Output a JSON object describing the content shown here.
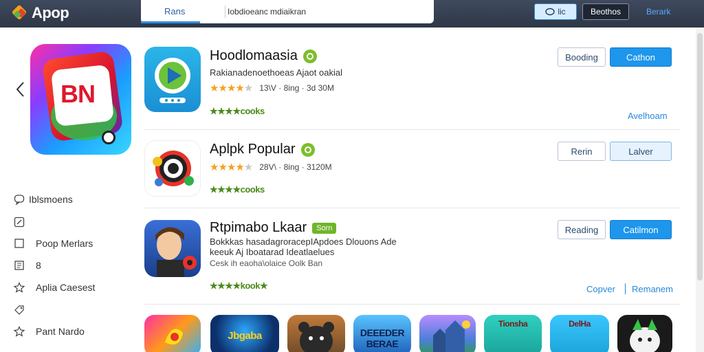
{
  "topbar": {
    "logo_text": "Apop",
    "tab_label": "Rans",
    "search_value": "Iobdioeanc mdiaikran",
    "button_1_label": "lic",
    "button_2_label": "Beothos",
    "link_label": "Berark"
  },
  "sidebar": {
    "items": [
      {
        "label": "Iblsmoens",
        "icon": "chat-bubble-icon"
      },
      {
        "label": "",
        "icon": "edit-icon"
      },
      {
        "label": "Poop Merlars",
        "icon": "square-icon"
      },
      {
        "label": "8",
        "icon": "bookmark-icon"
      },
      {
        "label": "Aplia Caesest",
        "icon": "star-outline-icon"
      },
      {
        "label": "",
        "icon": "tag-icon"
      },
      {
        "label": "Pant Nardo",
        "icon": "star-outline-icon"
      }
    ]
  },
  "apps": [
    {
      "title": "Hoodlomaasia",
      "badge": "circle",
      "subtitle": "Rakianadenoethoeas Ajaot oakial",
      "rating_stars": 4,
      "meta": "13\\V · 8ing · 3d 30M",
      "reviews": "★★★★cooks",
      "btn_secondary": "Booding",
      "btn_primary": "Cathon",
      "link": "Avelhoam"
    },
    {
      "title": "Aplpk Popular",
      "badge": "circle",
      "rating_stars": 4,
      "meta": "28V\\ · 8ing · 3120M",
      "reviews": "★★★★cooks",
      "btn_secondary": "Rerin",
      "btn_primary": "Lalver"
    },
    {
      "title": "Rtpimabo Lkaar",
      "badge_text": "Sorn",
      "subtitle": "Bokkkas hasadagroracepIApdoes Dlouons Ade",
      "subtitle2": "keeuk Aj Iboatarad Ideatlaelues",
      "meta_line": "Cesk ih eaoha\\olaice Oolk Ban",
      "reviews": "★★★★kook★",
      "btn_secondary": "Reading",
      "btn_primary": "Catilmon",
      "link_1": "Copver",
      "link_2": "Remanem"
    }
  ],
  "tiles": [
    {
      "label": "",
      "color": "#ff2fa4"
    },
    {
      "label": "Jbgaba",
      "color": "#0d2f6a"
    },
    {
      "label": "",
      "color": "#6b4a2a"
    },
    {
      "label": "DEEEDER BERAE",
      "color": "#1c7fd8"
    },
    {
      "label": "",
      "color": "#4c7fd8"
    },
    {
      "label": "Tionsha",
      "color": "#1aa39a"
    },
    {
      "label": "DelHa",
      "color": "#1aa3d8"
    },
    {
      "label": "",
      "color": "#1a1a1a"
    }
  ],
  "colors": {
    "accent": "#1e96ec",
    "topbar": "#2e3747",
    "rating": "#f2a31b",
    "badge_green": "#7bbf2a"
  }
}
